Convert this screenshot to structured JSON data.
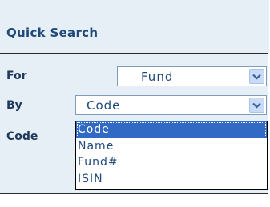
{
  "title": "Quick Search",
  "form": {
    "for_label": "For",
    "for_value": "Fund",
    "by_label": "By",
    "by_value": "Code",
    "code_label": "Code"
  },
  "by_options": [
    "Code",
    "Name",
    "Fund#",
    "ISIN"
  ],
  "colors": {
    "panel_bg": "#e6eef6",
    "title_text": "#1f4a7a",
    "selection": "#306ac5",
    "arrow_button": "#c9dbf7"
  }
}
